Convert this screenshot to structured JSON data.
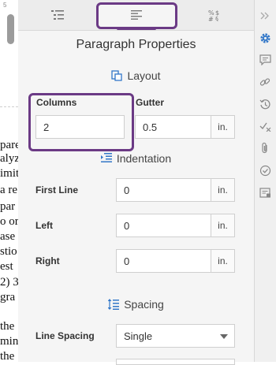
{
  "document": {
    "ruler_number": "5",
    "text_lines": [
      "pare",
      "alyz",
      "imit",
      "a re",
      "par",
      "o or",
      "ase",
      "stio",
      "est",
      "2) 3",
      "gra",
      "",
      "the",
      "min",
      "the"
    ]
  },
  "tabs": [
    {
      "name": "list-format",
      "icon": "list-indent-icon"
    },
    {
      "name": "paragraph",
      "icon": "paragraph-align-icon",
      "active": true
    },
    {
      "name": "format",
      "icon": "percent-hash-icon"
    }
  ],
  "panel_title": "Paragraph Properties",
  "sections": {
    "layout": "Layout",
    "indentation": "Indentation",
    "spacing": "Spacing"
  },
  "layout": {
    "columns_label": "Columns",
    "columns_value": "2",
    "gutter_label": "Gutter",
    "gutter_value": "0.5",
    "gutter_unit": "in."
  },
  "indentation": {
    "first_line_label": "First Line",
    "first_line_value": "0",
    "first_line_unit": "in.",
    "left_label": "Left",
    "left_value": "0",
    "left_unit": "in.",
    "right_label": "Right",
    "right_value": "0",
    "right_unit": "in."
  },
  "spacing": {
    "line_spacing_label": "Line Spacing",
    "line_spacing_value": "Single"
  },
  "colors": {
    "accent": "#3277c8",
    "highlight": "#6b3a85"
  },
  "rail_icons": [
    "chevron-double-right-icon",
    "gear-icon",
    "comment-icon",
    "link-icon",
    "history-icon",
    "track-changes-icon",
    "attachment-icon",
    "check-circle-icon",
    "notes-icon"
  ]
}
